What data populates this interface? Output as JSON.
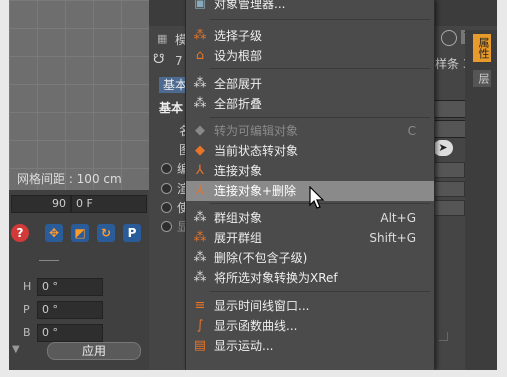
{
  "viewport": {
    "grid_spacing": "网格间距 : 100 cm"
  },
  "left_fields": {
    "frame_value": "90",
    "frame_unit": "0 F"
  },
  "left_coords": [
    {
      "label": "H",
      "value": "0 °"
    },
    {
      "label": "P",
      "value": "0 °"
    },
    {
      "label": "B",
      "value": "0 °"
    }
  ],
  "apply_label": "应用",
  "attr_panel": {
    "tab_label": "模",
    "num_label": "7",
    "basic_tab": "基本",
    "basic_header": "基本",
    "field_name": "名",
    "field_layer": "图",
    "radio_labels": [
      "编",
      "渲",
      "使",
      "显"
    ],
    "spline_text": "样条 3",
    "side_tabs": [
      "属性",
      "层"
    ]
  },
  "menu": {
    "top_partial": "对象管理器...",
    "items": [
      {
        "label": "选择子级",
        "shortcut": "",
        "icon": "select-children-icon",
        "disabled": false,
        "highlighted": false
      },
      {
        "label": "设为根部",
        "shortcut": "",
        "icon": "set-root-icon",
        "disabled": false,
        "highlighted": false
      },
      {
        "label": "全部展开",
        "shortcut": "",
        "icon": "expand-all-icon",
        "disabled": false,
        "highlighted": false
      },
      {
        "label": "全部折叠",
        "shortcut": "",
        "icon": "collapse-all-icon",
        "disabled": false,
        "highlighted": false
      },
      {
        "label": "转为可编辑对象",
        "shortcut": "C",
        "icon": "make-editable-icon",
        "disabled": true,
        "highlighted": false
      },
      {
        "label": "当前状态转对象",
        "shortcut": "",
        "icon": "current-state-to-object-icon",
        "disabled": false,
        "highlighted": false
      },
      {
        "label": "连接对象",
        "shortcut": "",
        "icon": "connect-objects-icon",
        "disabled": false,
        "highlighted": false
      },
      {
        "label": "连接对象+删除",
        "shortcut": "",
        "icon": "connect-delete-icon",
        "disabled": false,
        "highlighted": true
      },
      {
        "label": "群组对象",
        "shortcut": "Alt+G",
        "icon": "group-objects-icon",
        "disabled": false,
        "highlighted": false
      },
      {
        "label": "展开群组",
        "shortcut": "Shift+G",
        "icon": "expand-group-icon",
        "disabled": false,
        "highlighted": false
      },
      {
        "label": "删除(不包含子级)",
        "shortcut": "",
        "icon": "delete-without-children-icon",
        "disabled": false,
        "highlighted": false
      },
      {
        "label": "将所选对象转换为XRef",
        "shortcut": "",
        "icon": "convert-xref-icon",
        "disabled": false,
        "highlighted": false
      },
      {
        "label": "显示时间线窗口...",
        "shortcut": "",
        "icon": "timeline-window-icon",
        "disabled": false,
        "highlighted": false
      },
      {
        "label": "显示函数曲线...",
        "shortcut": "",
        "icon": "function-curves-icon",
        "disabled": false,
        "highlighted": false
      },
      {
        "label": "显示运动...",
        "shortcut": "",
        "icon": "show-motion-icon",
        "disabled": false,
        "highlighted": false
      }
    ]
  }
}
